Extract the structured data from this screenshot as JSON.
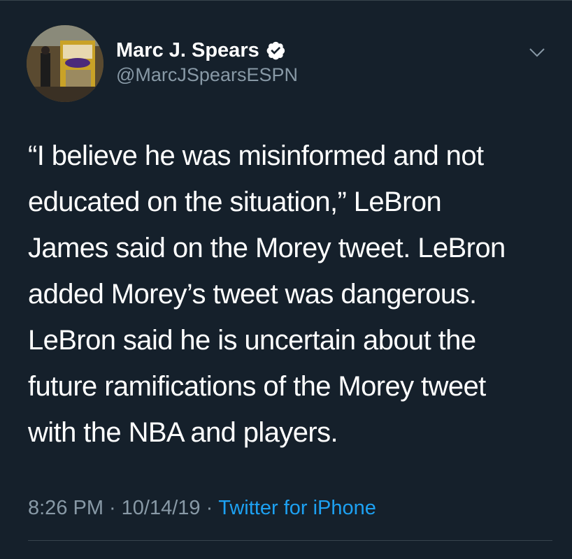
{
  "author": {
    "display_name": "Marc J. Spears",
    "handle": "@MarcJSpearsESPN",
    "verified": true
  },
  "tweet": {
    "lines": [
      "“I believe he was misinformed and not",
      "educated on the situation,” LeBron",
      "James said on the Morey tweet. LeBron",
      "added Morey’s tweet was dangerous.",
      "LeBron said he is uncertain about the",
      "future ramifications of the Morey tweet",
      "with the NBA and players."
    ],
    "time": "8:26 PM",
    "separator": "·",
    "date": "10/14/19",
    "source": "Twitter for iPhone"
  },
  "icons": {
    "verified": "verified-badge-icon",
    "menu": "chevron-down-icon"
  },
  "colors": {
    "background": "#15202b",
    "text": "#ffffff",
    "secondary_text": "#8899a6",
    "link": "#1da1f2",
    "divider": "#38444d"
  }
}
